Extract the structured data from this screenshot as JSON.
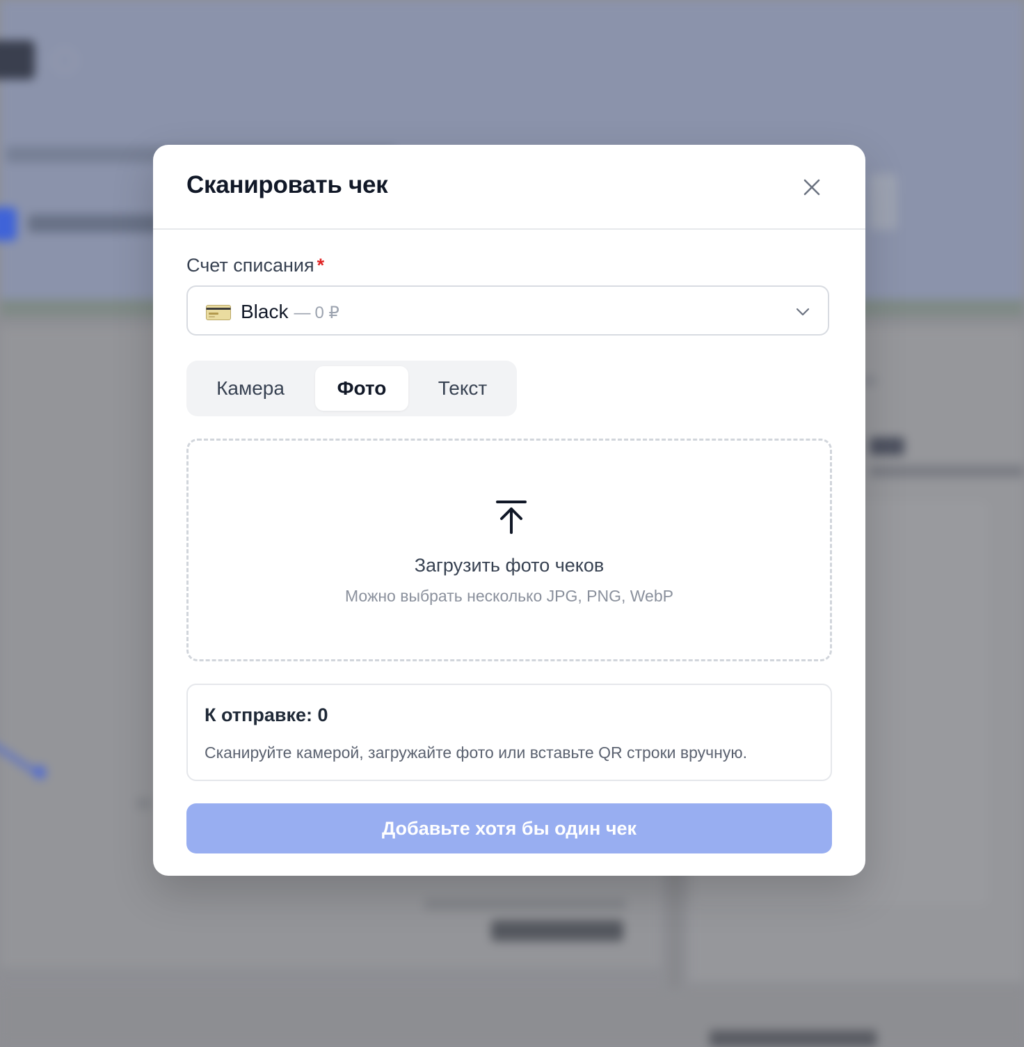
{
  "modal": {
    "title": "Сканировать чек",
    "close_icon": "close-icon"
  },
  "account_field": {
    "label": "Счет списания",
    "required_mark": "*",
    "selected_name": "Black",
    "separator": "—",
    "selected_amount": "0 ₽",
    "card_icon": "credit-card-icon",
    "chevron_icon": "chevron-down-icon"
  },
  "tabs": [
    {
      "label": "Камера",
      "active": false
    },
    {
      "label": "Фото",
      "active": true
    },
    {
      "label": "Текст",
      "active": false
    }
  ],
  "upload": {
    "icon": "upload-icon",
    "title": "Загрузить фото чеков",
    "subtitle": "Можно выбрать несколько JPG, PNG, WebP"
  },
  "queue": {
    "title": "К отправке: 0",
    "hint": "Сканируйте камерой, загружайте фото или вставьте QR строки вручную."
  },
  "submit": {
    "label": "Добавьте хотя бы один чек",
    "disabled": true
  },
  "colors": {
    "primary_disabled": "#98aef1",
    "required": "#e02424",
    "backdrop": "#8e8f94"
  }
}
